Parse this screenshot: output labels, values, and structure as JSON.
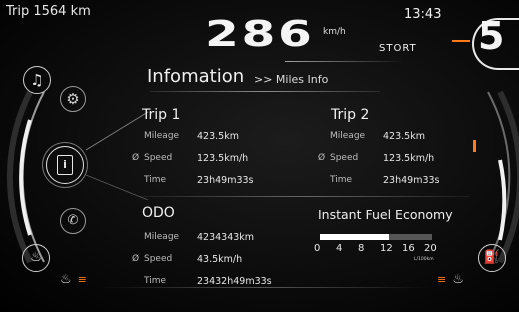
{
  "header": {
    "trip_text": "Trip 1564 km",
    "speed_value": "286",
    "speed_unit": "km/h",
    "mode": "STORT",
    "time": "13:43",
    "gear": "5"
  },
  "page": {
    "title": "Infomation",
    "breadcrumb": ">> Miles Info"
  },
  "trip1": {
    "title": "Trip 1",
    "mileage_label": "Mileage",
    "mileage_value": "423.5km",
    "speed_label": "Speed",
    "speed_value": "123.5km/h",
    "time_label": "Time",
    "time_value": "23h49m33s"
  },
  "trip2": {
    "title": "Trip 2",
    "mileage_label": "Mileage",
    "mileage_value": "423.5km",
    "speed_label": "Speed",
    "speed_value": "123.5km/h",
    "time_label": "Time",
    "time_value": "23h49m33s"
  },
  "odo": {
    "title": "ODO",
    "mileage_label": "Mileage",
    "mileage_value": "4234343km",
    "speed_label": "Speed",
    "speed_value": "43.5km/h",
    "time_label": "Time",
    "time_value": "23432h49m33s"
  },
  "fuel": {
    "title": "Instant Fuel Economy",
    "scale": [
      "0",
      "4",
      "8",
      "12",
      "16",
      "20"
    ],
    "unit": "L/100km",
    "level_fraction": 0.62
  },
  "symbols": {
    "avg": "Ø"
  },
  "colors": {
    "accent": "#ff7a1a",
    "fuel_bar_fill": "#ffffff",
    "fuel_bar_empty": "#555555"
  },
  "icons": [
    "music-icon",
    "settings-gear-icon",
    "info-icon",
    "phone-icon",
    "coolant-temp-icon",
    "seat-heat-left-icon",
    "seat-heat-right-icon",
    "fuel-pump-icon"
  ]
}
